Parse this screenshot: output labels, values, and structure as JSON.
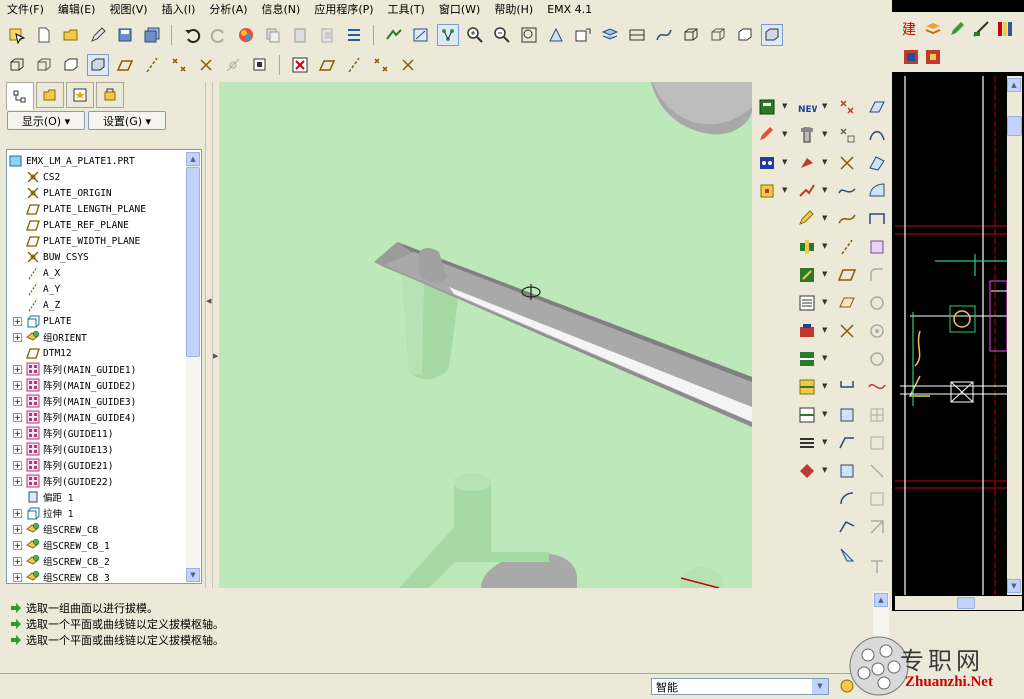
{
  "menu": [
    "文件(F)",
    "编辑(E)",
    "视图(V)",
    "插入(I)",
    "分析(A)",
    "信息(N)",
    "应用程序(P)",
    "工具(T)",
    "窗口(W)",
    "帮助(H)",
    "EMX 4.1"
  ],
  "filters": {
    "show_label": "显示(O) ▾",
    "settings_label": "设置(G) ▾"
  },
  "tree": {
    "root": "EMX_LM_A_PLATE1.PRT",
    "items": [
      {
        "label": "CS2",
        "icon": "csys-icon",
        "expandable": false
      },
      {
        "label": "PLATE_ORIGIN",
        "icon": "csys-icon",
        "expandable": false
      },
      {
        "label": "PLATE_LENGTH_PLANE",
        "icon": "datum-plane-icon",
        "expandable": false
      },
      {
        "label": "PLATE_REF_PLANE",
        "icon": "datum-plane-icon",
        "expandable": false
      },
      {
        "label": "PLATE_WIDTH_PLANE",
        "icon": "datum-plane-icon",
        "expandable": false
      },
      {
        "label": "BUW_CSYS",
        "icon": "csys-icon",
        "expandable": false
      },
      {
        "label": "A_X",
        "icon": "datum-axis-icon",
        "expandable": false
      },
      {
        "label": "A_Y",
        "icon": "datum-axis-icon",
        "expandable": false
      },
      {
        "label": "A_Z",
        "icon": "datum-axis-icon",
        "expandable": false
      },
      {
        "label": "PLATE",
        "icon": "extrude-icon",
        "expandable": true
      },
      {
        "label": "组ORIENT",
        "icon": "group-icon",
        "expandable": true
      },
      {
        "label": "DTM12",
        "icon": "datum-plane-icon",
        "expandable": false
      },
      {
        "label": "阵列(MAIN_GUIDE1)",
        "icon": "pattern-icon",
        "expandable": true
      },
      {
        "label": "阵列(MAIN_GUIDE2)",
        "icon": "pattern-icon",
        "expandable": true
      },
      {
        "label": "阵列(MAIN_GUIDE3)",
        "icon": "pattern-icon",
        "expandable": true
      },
      {
        "label": "阵列(MAIN_GUIDE4)",
        "icon": "pattern-icon",
        "expandable": true
      },
      {
        "label": "阵列(GUIDE11)",
        "icon": "pattern-icon",
        "expandable": true
      },
      {
        "label": "阵列(GUIDE13)",
        "icon": "pattern-icon",
        "expandable": true
      },
      {
        "label": "阵列(GUIDE21)",
        "icon": "pattern-icon",
        "expandable": true
      },
      {
        "label": "阵列(GUIDE22)",
        "icon": "pattern-icon",
        "expandable": true
      },
      {
        "label": "偏距 1",
        "icon": "offset-icon",
        "expandable": false
      },
      {
        "label": "拉伸 1",
        "icon": "extrude-icon",
        "expandable": true
      },
      {
        "label": "组SCREW_CB",
        "icon": "group-icon",
        "expandable": true
      },
      {
        "label": "组SCREW_CB_1",
        "icon": "group-icon",
        "expandable": true
      },
      {
        "label": "组SCREW_CB_2",
        "icon": "group-icon",
        "expandable": true
      },
      {
        "label": "组SCREW_CB_3",
        "icon": "group-icon",
        "expandable": true
      }
    ]
  },
  "messages": [
    "选取一组曲面以进行拔模。",
    "选取一个平面或曲线链以定义拔模枢轴。",
    "选取一个平面或曲线链以定义拔模枢轴。"
  ],
  "status": {
    "filter_value": "智能"
  },
  "right_app": {
    "toolbar_glyph": "建"
  },
  "watermark": {
    "text": "专职网",
    "url": "Zhuanzhi.Net"
  },
  "colors": {
    "viewport_bg": "#bde8ba",
    "model_gray": "#a9a9a9",
    "model_green": "#a6d9a3",
    "prompt_arrow": "#2e9d2e"
  }
}
